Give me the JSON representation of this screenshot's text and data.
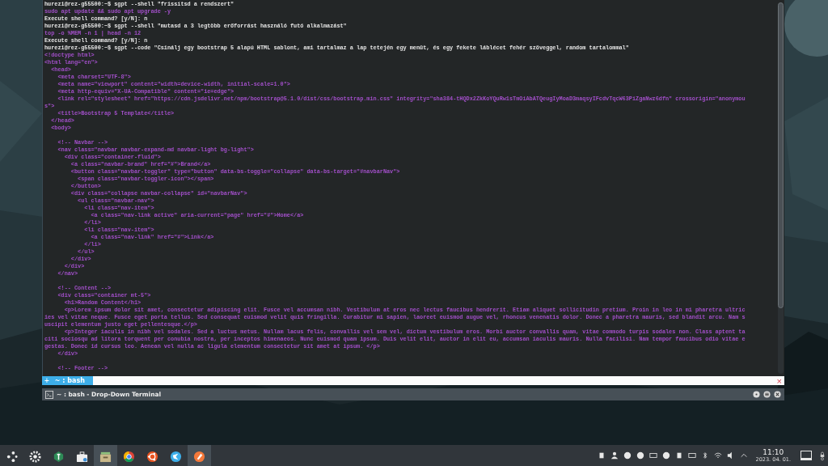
{
  "terminal": {
    "lines": [
      {
        "kind": "prompt",
        "text": "hurezi@rez-g55500:~$ sgpt --shell \"frissítsd a rendszert\""
      },
      {
        "kind": "code",
        "text": "sudo apt update && sudo apt upgrade -y"
      },
      {
        "kind": "prompt",
        "text": "Execute shell command? [y/N]: n"
      },
      {
        "kind": "prompt",
        "text": "hurezi@rez-g55500:~$ sgpt --shell \"mutasd a 3 legtöbb erőforrást használó futó alkalmazást\""
      },
      {
        "kind": "code",
        "text": "top -o %MEM -n 1 | head -n 12"
      },
      {
        "kind": "prompt",
        "text": "Execute shell command? [y/N]: n"
      },
      {
        "kind": "prompt",
        "text": "hurezi@rez-g55500:~$ sgpt --code \"Csinálj egy bootstrap 5 alapú HTML sablont, ami tartalmaz a lap tetején egy menüt, és egy fekete láblécet fehér szöveggel, random tartalommal\""
      },
      {
        "kind": "code",
        "text": "<!doctype html>"
      },
      {
        "kind": "code",
        "text": "<html lang=\"en\">"
      },
      {
        "kind": "code",
        "text": "  <head>"
      },
      {
        "kind": "code",
        "text": "    <meta charset=\"UTF-8\">"
      },
      {
        "kind": "code",
        "text": "    <meta name=\"viewport\" content=\"width=device-width, initial-scale=1.0\">"
      },
      {
        "kind": "code",
        "text": "    <meta http-equiv=\"X-UA-Compatible\" content=\"ie=edge\">"
      },
      {
        "kind": "code",
        "text": "    <link rel=\"stylesheet\" href=\"https://cdn.jsdelivr.net/npm/bootstrap@5.1.0/dist/css/bootstrap.min.css\" integrity=\"sha384-tHQDx2ZkKoYQuRw1sTmOiAbATQeugIyMoaD3maqsyIFcdvTqcW63PiZgaNwz6dfn\" crossorigin=\"anonymou"
      },
      {
        "kind": "code",
        "text": "s\">"
      },
      {
        "kind": "code",
        "text": "    <title>Bootstrap 5 Template</title>"
      },
      {
        "kind": "code",
        "text": "  </head>"
      },
      {
        "kind": "code",
        "text": "  <body>"
      },
      {
        "kind": "blank"
      },
      {
        "kind": "code",
        "text": "    <!-- Navbar -->"
      },
      {
        "kind": "code",
        "text": "    <nav class=\"navbar navbar-expand-md navbar-light bg-light\">"
      },
      {
        "kind": "code",
        "text": "      <div class=\"container-fluid\">"
      },
      {
        "kind": "code",
        "text": "        <a class=\"navbar-brand\" href=\"#\">Brand</a>"
      },
      {
        "kind": "code",
        "text": "        <button class=\"navbar-toggler\" type=\"button\" data-bs-toggle=\"collapse\" data-bs-target=\"#navbarNav\">"
      },
      {
        "kind": "code",
        "text": "          <span class=\"navbar-toggler-icon\"></span>"
      },
      {
        "kind": "code",
        "text": "        </button>"
      },
      {
        "kind": "code",
        "text": "        <div class=\"collapse navbar-collapse\" id=\"navbarNav\">"
      },
      {
        "kind": "code",
        "text": "          <ul class=\"navbar-nav\">"
      },
      {
        "kind": "code",
        "text": "            <li class=\"nav-item\">"
      },
      {
        "kind": "code",
        "text": "              <a class=\"nav-link active\" aria-current=\"page\" href=\"#\">Home</a>"
      },
      {
        "kind": "code",
        "text": "            </li>"
      },
      {
        "kind": "code",
        "text": "            <li class=\"nav-item\">"
      },
      {
        "kind": "code",
        "text": "              <a class=\"nav-link\" href=\"#\">Link</a>"
      },
      {
        "kind": "code",
        "text": "            </li>"
      },
      {
        "kind": "code",
        "text": "          </ul>"
      },
      {
        "kind": "code",
        "text": "        </div>"
      },
      {
        "kind": "code",
        "text": "      </div>"
      },
      {
        "kind": "code",
        "text": "    </nav>"
      },
      {
        "kind": "blank"
      },
      {
        "kind": "code",
        "text": "    <!-- Content -->"
      },
      {
        "kind": "code",
        "text": "    <div class=\"container mt-5\">"
      },
      {
        "kind": "code",
        "text": "      <h1>Random Content</h1>"
      },
      {
        "kind": "code",
        "text": "      <p>Lorem ipsum dolor sit amet, consectetur adipiscing elit. Fusce vel accumsan nibh. Vestibulum at eros nec lectus faucibus hendrerit. Etiam aliquet sollicitudin pretium. Proin in leo in mi pharetra ultric"
      },
      {
        "kind": "code",
        "text": "ies vel vitae neque. Fusce eget porta tellus. Sed consequat euismod velit quis fringilla. Curabitur mi sapien, laoreet euismod augue vel, rhoncus venenatis dolor. Donec a pharetra mauris, sed blandit arcu. Nam s"
      },
      {
        "kind": "code",
        "text": "uscipit elementum justo eget pellentesque.</p>"
      },
      {
        "kind": "code",
        "text": "      <p>Integer iaculis in nibh vel sodales. Sed a luctus metus. Nullam lacus felis, convallis vel sem vel, dictum vestibulum eros. Morbi auctor convallis quam, vitae commodo turpis sodales non. Class aptent ta"
      },
      {
        "kind": "code",
        "text": "citi sociosqu ad litora torquent per conubia nostra, per inceptos himenaeos. Nunc euismod quam ipsum. Duis velit elit, auctor in elit eu, accumsan iaculis mauris. Nulla facilisi. Nam tempor faucibus odio vitae e"
      },
      {
        "kind": "code",
        "text": "gestas. Donec id cursus leo. Aenean vel nulla ac ligula elementum consectetur sit amet at ipsum. </p>"
      },
      {
        "kind": "code",
        "text": "    </div>"
      },
      {
        "kind": "blank"
      },
      {
        "kind": "code",
        "text": "    <!-- Footer -->"
      }
    ],
    "new_tab": "+",
    "tabs": [
      {
        "label": "~ : bash",
        "selected": true
      }
    ],
    "close": "×",
    "title": "~ : bash - Drop-Down Terminal"
  },
  "taskbar": {
    "apps": [
      {
        "kind": "launcher",
        "selected": false
      },
      {
        "kind": "gear",
        "selected": false
      },
      {
        "kind": "wrench",
        "selected": false
      },
      {
        "kind": "briefcase",
        "selected": false
      },
      {
        "kind": "files",
        "selected": true
      },
      {
        "kind": "browser",
        "selected": false
      },
      {
        "kind": "ubuntu",
        "selected": false
      },
      {
        "kind": "bird",
        "selected": false
      },
      {
        "kind": "pen",
        "selected": true
      }
    ],
    "time": "11:10",
    "date": "2023. 04. 01."
  }
}
